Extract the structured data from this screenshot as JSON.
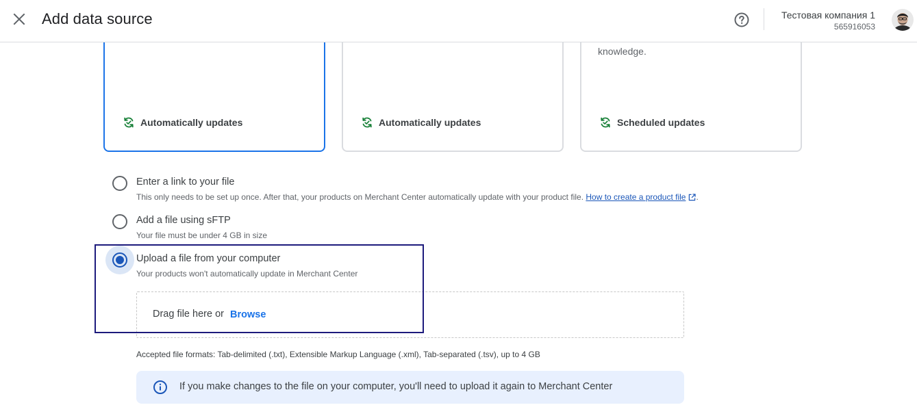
{
  "header": {
    "title": "Add data source",
    "account_name": "Тестовая компания 1",
    "account_id": "565916053",
    "close_icon": "close-icon",
    "help_icon": "help-icon"
  },
  "cards": [
    {
      "description": "",
      "update_label": "Automatically updates",
      "selected": true
    },
    {
      "description": "",
      "update_label": "Automatically updates",
      "selected": false
    },
    {
      "description": "knowledge.",
      "update_label": "Scheduled updates",
      "selected": false
    }
  ],
  "options": {
    "link": {
      "label": "Enter a link to your file",
      "sub": "This only needs to be set up once. After that, your products on Merchant Center automatically update with your product file.",
      "link_text": "How to create a product file",
      "trailing": ".",
      "checked": false
    },
    "sftp": {
      "label": "Add a file using sFTP",
      "sub": "Your file must be under 4 GB in size",
      "checked": false
    },
    "upload": {
      "label": "Upload a file from your computer",
      "sub": "Your products won't automatically update in Merchant Center",
      "checked": true
    }
  },
  "dropzone": {
    "drag_text": "Drag file here or",
    "browse_label": "Browse"
  },
  "accepted_formats": "Accepted file formats: Tab-delimited (.txt), Extensible Markup Language (.xml), Tab-separated (.tsv), up to 4 GB",
  "info": {
    "text": "If you make changes to the file on your computer, you'll need to upload it again to Merchant Center"
  },
  "colors": {
    "accent": "#1a73e8",
    "radio_checked": "#1a56b8",
    "update_icon": "#188038",
    "info_bg": "#e8f0fe",
    "highlight": "#1c1a7c"
  }
}
